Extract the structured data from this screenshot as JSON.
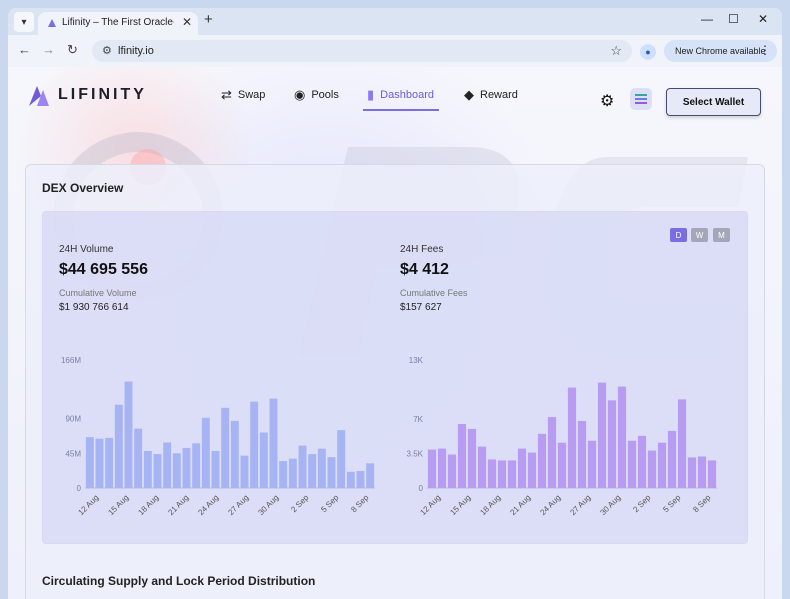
{
  "browser": {
    "tab_title": "Lifinity – The First Oracle-Based",
    "url": "lfinity.io",
    "update_chip": "New Chrome available"
  },
  "site": {
    "logo": "LIFINITY",
    "nav": [
      {
        "label": "Swap",
        "icon": "swap-icon"
      },
      {
        "label": "Pools",
        "icon": "coins-icon"
      },
      {
        "label": "Dashboard",
        "icon": "bar-chart-icon",
        "active": true
      },
      {
        "label": "Reward",
        "icon": "diamond-icon"
      }
    ],
    "wallet_button": "Select Wallet",
    "accent_color": "#7b6ee3"
  },
  "overview": {
    "title": "DEX Overview",
    "periods": [
      "D",
      "W",
      "M"
    ],
    "selected_period": "D",
    "volume_label": "24H Volume",
    "volume_value": "$44 695 556",
    "cum_volume_label": "Cumulative Volume",
    "cum_volume_value": "$1 930 766 614",
    "fees_label": "24H Fees",
    "fees_value": "$4 412",
    "cum_fees_label": "Cumulative Fees",
    "cum_fees_value": "$157 627"
  },
  "chart_data": [
    {
      "type": "bar",
      "color": "#a7b4f3",
      "yticks": [
        "0",
        "45M",
        "90M",
        "166M"
      ],
      "ylim": [
        0,
        166
      ],
      "xticks": [
        "12 Aug",
        "15 Aug",
        "18 Aug",
        "21 Aug",
        "24 Aug",
        "27 Aug",
        "30 Aug",
        "2 Sep",
        "5 Sep",
        "8 Sep"
      ],
      "values": [
        66,
        64,
        65,
        108,
        138,
        77,
        48,
        44,
        59,
        45,
        52,
        58,
        91,
        48,
        104,
        87,
        42,
        112,
        72,
        116,
        35,
        38,
        55,
        44,
        51,
        40,
        75,
        21,
        22,
        32
      ]
    },
    {
      "type": "bar",
      "color": "#b79cf1",
      "yticks": [
        "0",
        "3.5K",
        "7K",
        "13K"
      ],
      "ylim": [
        0,
        13
      ],
      "xticks": [
        "12 Aug",
        "15 Aug",
        "18 Aug",
        "21 Aug",
        "24 Aug",
        "27 Aug",
        "30 Aug",
        "2 Sep",
        "5 Sep",
        "8 Sep"
      ],
      "values": [
        3.9,
        4.0,
        3.4,
        6.5,
        6.0,
        4.2,
        2.9,
        2.8,
        2.8,
        4.0,
        3.6,
        5.5,
        7.2,
        4.6,
        10.2,
        6.8,
        4.8,
        10.7,
        8.9,
        10.3,
        4.8,
        5.3,
        3.8,
        4.6,
        5.8,
        9.0,
        3.1,
        3.2,
        2.8
      ]
    }
  ],
  "section2_title": "Circulating Supply and Lock Period Distribution"
}
